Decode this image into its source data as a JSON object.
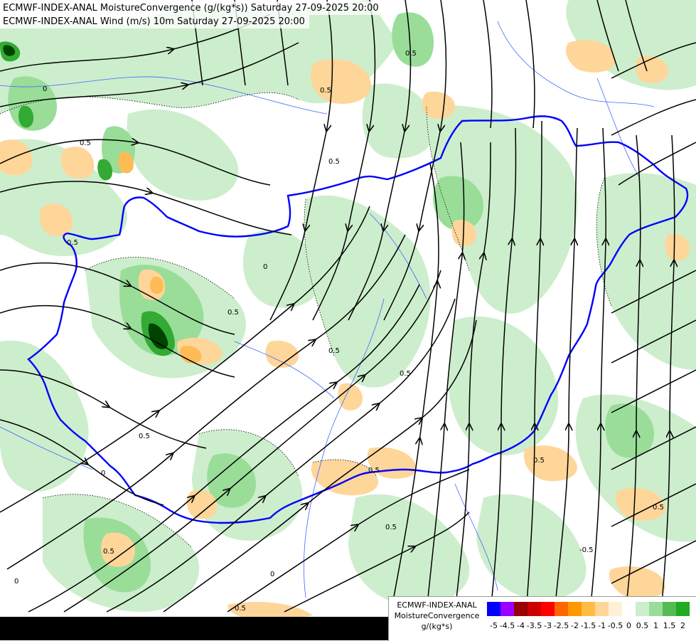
{
  "header": {
    "line1": "ECMWF-INDEX-ANAL MoistureConvergence (g/(kg*s)) Saturday 27-09-2025 20:00",
    "line2": "ECMWF-INDEX-ANAL Wind (m/s) 10m Saturday 27-09-2025 20:00"
  },
  "legend": {
    "title1": "ECMWF-INDEX-ANAL",
    "title2": "MoistureConvergence",
    "unit": "g/(kg*s)",
    "ticks": [
      "-5",
      "-4.5",
      "-4",
      "-3.5",
      "-3",
      "-2.5",
      "-2",
      "-1.5",
      "-1",
      "-0.5",
      "0",
      "0.5",
      "1",
      "1.5",
      "2"
    ],
    "colors": [
      "#0000ff",
      "#9900ff",
      "#990000",
      "#cc0000",
      "#ff0000",
      "#ff6600",
      "#ff9900",
      "#ffbb44",
      "#ffd699",
      "#fff0d8",
      "#ffffff",
      "#cceecc",
      "#99dd99",
      "#55bb55",
      "#22aa22"
    ]
  },
  "map": {
    "contour_labels": [
      "0",
      "0.5",
      "-0.5"
    ],
    "colors": {
      "border": "#0000ff",
      "rivers": "#4466ff",
      "streamlines": "#000000",
      "convergence_light": "#cceecc",
      "convergence_mid": "#99dd99",
      "convergence_strong": "#33aa33",
      "divergence_light": "#ffd699",
      "divergence_mid": "#ffbb55"
    }
  }
}
